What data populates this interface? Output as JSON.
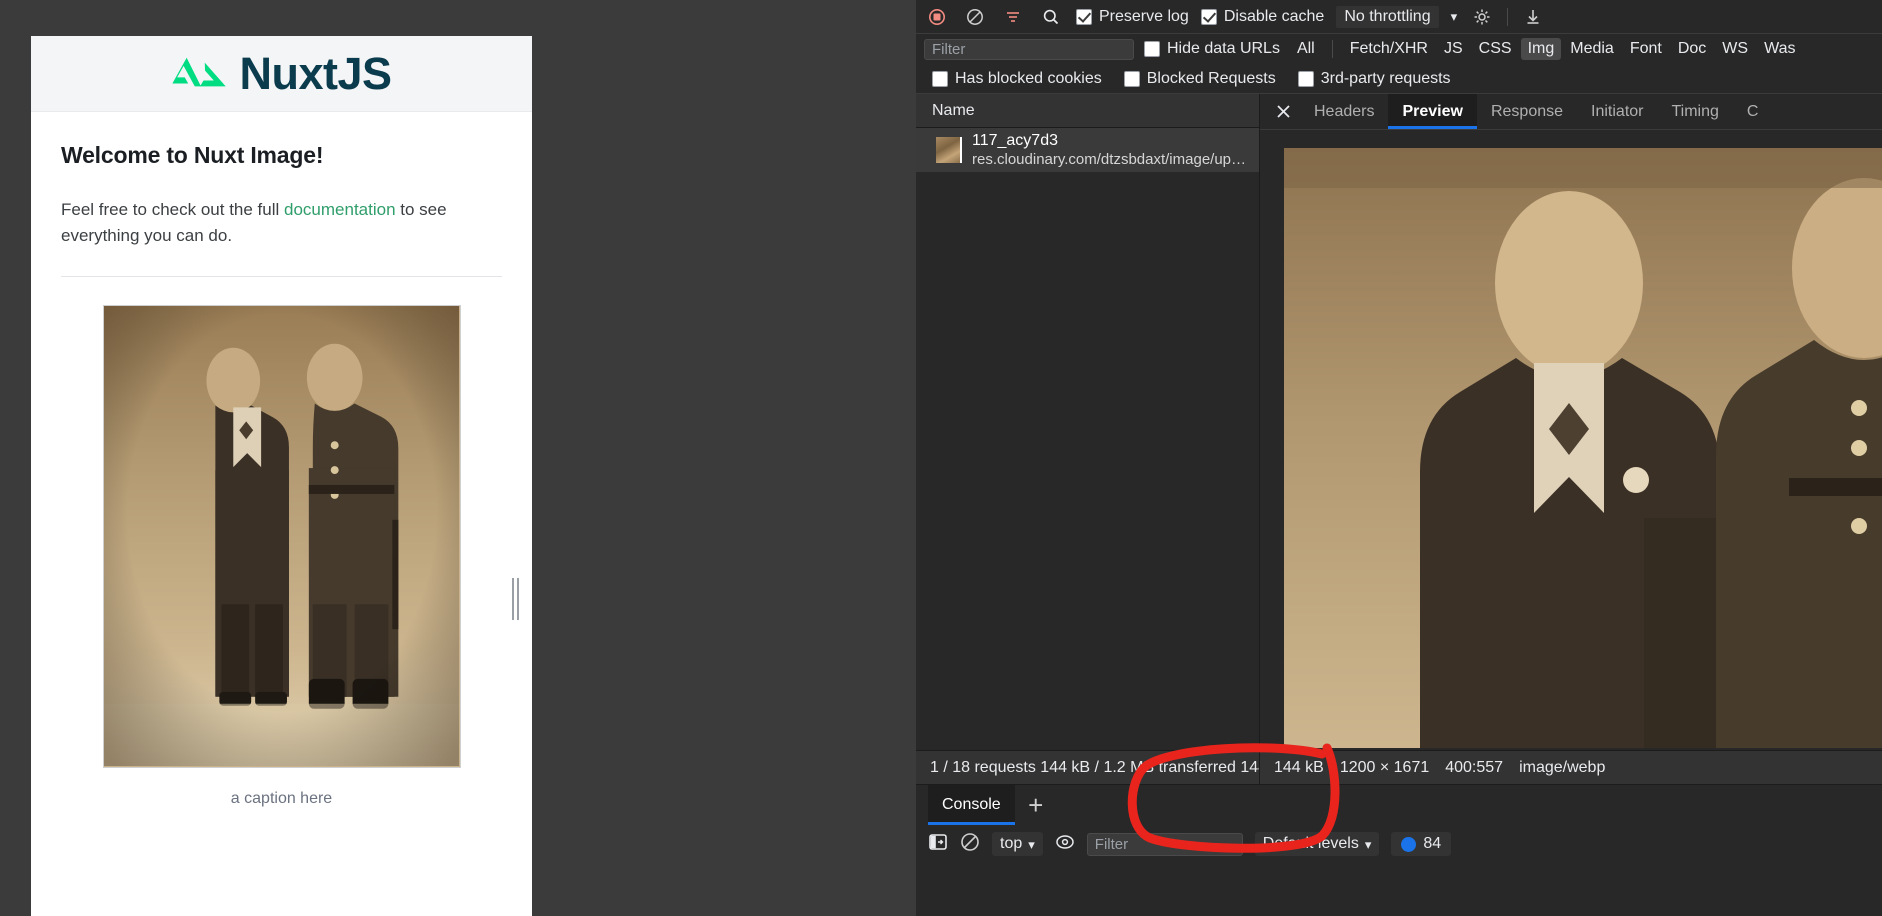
{
  "webpage": {
    "logo_text": "NuxtJS",
    "logo_icon": "nuxt-triangle-logo",
    "heading": "Welcome to Nuxt Image!",
    "paragraph_before_link": "Feel free to check out the full ",
    "link_text": "documentation",
    "paragraph_after_link": " to see everything you can do.",
    "image_caption": "a caption here",
    "brand_green": "#00dc82",
    "brand_dark": "#0b3c4d",
    "link_color": "#2f9e6b"
  },
  "devtools": {
    "toolbar": {
      "record_icon": "record-stop-icon",
      "clear_icon": "clear-network-log-icon",
      "filter_icon": "filter-icon",
      "search_icon": "search-icon",
      "preserve_log_label": "Preserve log",
      "preserve_log_checked": true,
      "disable_cache_label": "Disable cache",
      "disable_cache_checked": true,
      "throttling_label": "No throttling",
      "throttling_caret": "▾",
      "settings_icon": "gear-icon",
      "import_icon": "import-har-icon",
      "export_icon": "export-har-icon"
    },
    "filterbar": {
      "filter_placeholder": "Filter",
      "filter_value": "",
      "hide_data_urls_label": "Hide data URLs",
      "hide_data_urls_checked": false,
      "types": [
        "All",
        "Fetch/XHR",
        "JS",
        "CSS",
        "Img",
        "Media",
        "Font",
        "Doc",
        "WS",
        "Was"
      ],
      "active_type": "Img",
      "has_blocked_cookies_label": "Has blocked cookies",
      "has_blocked_cookies_checked": false,
      "blocked_requests_label": "Blocked Requests",
      "blocked_requests_checked": false,
      "third_party_label": "3rd-party requests",
      "third_party_checked": false
    },
    "requests": {
      "column_header": "Name",
      "rows": [
        {
          "name": "117_acy7d3",
          "url": "res.cloudinary.com/dtzsbdaxt/image/up…",
          "thumb_icon": "image-thumbnail"
        }
      ],
      "status_text": "1 / 18 requests  144 kB / 1.2 MB transferred  144"
    },
    "detail": {
      "close_icon": "close-icon",
      "tabs": [
        "Headers",
        "Preview",
        "Response",
        "Initiator",
        "Timing",
        "C"
      ],
      "active_tab": "Preview",
      "preview_image_alt": "sepia photograph of two men",
      "status": {
        "size": "144 kB",
        "dimensions": "1200 × 1671",
        "ratio": "400:557",
        "mime": "image/webp"
      }
    },
    "drawer": {
      "tab_label": "Console",
      "add_tab_icon": "plus-icon",
      "sidebar_icon": "console-sidebar-icon",
      "clear_icon": "clear-console-icon",
      "context_value": "top",
      "context_caret": "▾",
      "eye_icon": "live-expression-icon",
      "filter_placeholder": "Filter",
      "filter_value": "",
      "levels_label": "Default levels",
      "levels_caret": "▾",
      "message_count": "84"
    }
  },
  "annotation": {
    "shape": "hand-drawn-red-oval",
    "color": "#e8241c"
  }
}
